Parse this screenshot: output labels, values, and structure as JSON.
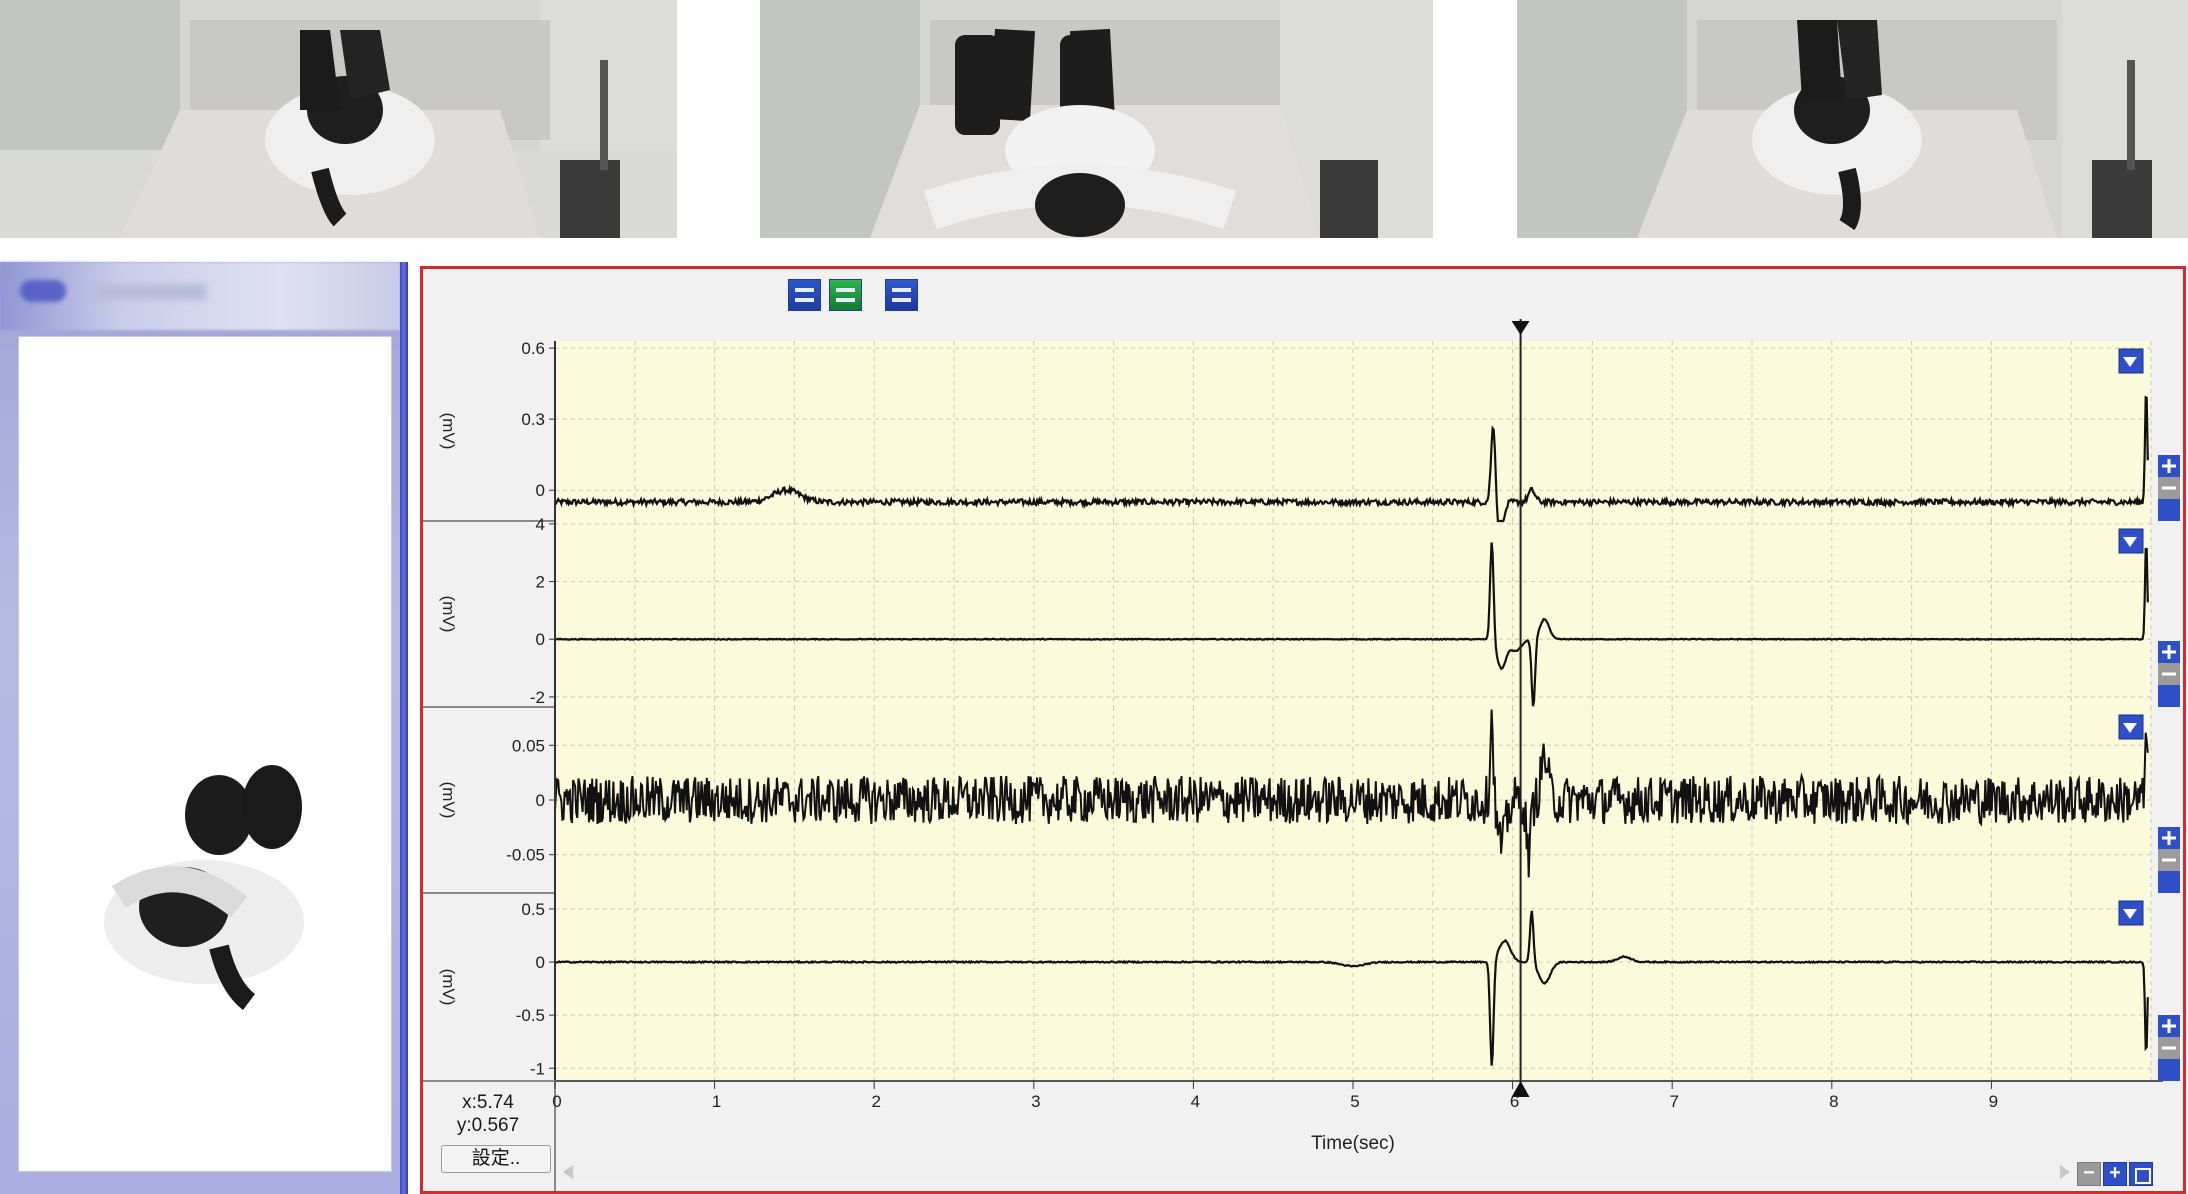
{
  "photos": [
    {
      "pose": "lying-on-left-side"
    },
    {
      "pose": "lying-supine"
    },
    {
      "pose": "lying-on-right-side"
    }
  ],
  "video_panel": {
    "title": ""
  },
  "toolbar": {
    "icons": [
      "waveform-mode-icon",
      "overlay-mode-icon",
      "spectrum-mode-icon"
    ]
  },
  "readout": {
    "x": "x:5.74",
    "y": "y:0.567"
  },
  "settings_label": "設定..",
  "colors": {
    "plot_background": "#fbfadb",
    "trace": "#111111",
    "grid": "#c9c9bd",
    "panel_border": "#d42a2a",
    "button_blue": "#2e4fc7"
  },
  "chart_data": {
    "type": "line",
    "xlabel": "Time(sec)",
    "xlim": [
      0,
      10
    ],
    "x_ticks": [
      "0",
      "1",
      "2",
      "3",
      "4",
      "5",
      "6",
      "7",
      "8",
      "9"
    ],
    "cursor_x": 6.05,
    "grid": true,
    "channels": [
      {
        "ylabel": "(mV)",
        "ylim": [
          -0.13,
          0.63
        ],
        "y_ticks": [
          {
            "v": 0.6,
            "t": "0.6"
          },
          {
            "v": 0.3,
            "t": "0.3"
          },
          {
            "v": 0,
            "t": "0"
          }
        ],
        "baseline": -0.05,
        "noise": 0.012,
        "events": [
          {
            "x": 1.45,
            "amp": 0.05,
            "w": 0.12
          },
          {
            "x": 5.88,
            "amp": 0.35,
            "w": 0.02
          },
          {
            "x": 5.92,
            "amp": -0.18,
            "w": 0.03
          },
          {
            "x": 6.12,
            "amp": 0.05,
            "w": 0.03
          },
          {
            "x": 9.97,
            "amp": 0.5,
            "w": 0.01
          }
        ]
      },
      {
        "ylabel": "(mV)",
        "ylim": [
          -2.35,
          4.1
        ],
        "y_ticks": [
          {
            "v": 4,
            "t": "4"
          },
          {
            "v": 2,
            "t": "2"
          },
          {
            "v": 0,
            "t": "0"
          },
          {
            "v": -2,
            "t": "-2"
          }
        ],
        "baseline": 0,
        "noise": 0.015,
        "events": [
          {
            "x": 5.87,
            "amp": 3.5,
            "w": 0.015
          },
          {
            "x": 5.93,
            "amp": -1.0,
            "w": 0.04
          },
          {
            "x": 6.02,
            "amp": -0.4,
            "w": 0.05
          },
          {
            "x": 6.13,
            "amp": -2.4,
            "w": 0.015
          },
          {
            "x": 6.2,
            "amp": 0.7,
            "w": 0.04
          },
          {
            "x": 9.97,
            "amp": 3.5,
            "w": 0.01
          }
        ]
      },
      {
        "ylabel": "(mV)",
        "ylim": [
          -0.085,
          0.085
        ],
        "y_ticks": [
          {
            "v": 0.05,
            "t": "0.05"
          },
          {
            "v": 0,
            "t": "0"
          },
          {
            "v": -0.05,
            "t": "-0.05"
          }
        ],
        "baseline": 0,
        "noise": 0.01,
        "events": [
          {
            "x": 5.87,
            "amp": 0.08,
            "w": 0.015
          },
          {
            "x": 5.93,
            "amp": -0.04,
            "w": 0.04
          },
          {
            "x": 6.1,
            "amp": -0.05,
            "w": 0.02
          },
          {
            "x": 6.2,
            "amp": 0.04,
            "w": 0.03
          },
          {
            "x": 9.97,
            "amp": 0.06,
            "w": 0.01
          }
        ]
      },
      {
        "ylabel": "(mV)",
        "ylim": [
          -1.12,
          0.65
        ],
        "y_ticks": [
          {
            "v": 0.5,
            "t": "0.5"
          },
          {
            "v": 0,
            "t": "0"
          },
          {
            "v": -0.5,
            "t": "-0.5"
          },
          {
            "v": -1,
            "t": "-1"
          }
        ],
        "baseline": 0,
        "noise": 0.006,
        "events": [
          {
            "x": 5.0,
            "amp": -0.04,
            "w": 0.1
          },
          {
            "x": 5.87,
            "amp": -1.0,
            "w": 0.015
          },
          {
            "x": 5.95,
            "amp": 0.2,
            "w": 0.05
          },
          {
            "x": 6.05,
            "amp": 0.0,
            "w": 0.05
          },
          {
            "x": 6.12,
            "amp": 0.5,
            "w": 0.015
          },
          {
            "x": 6.2,
            "amp": -0.2,
            "w": 0.05
          },
          {
            "x": 6.7,
            "amp": 0.05,
            "w": 0.06
          },
          {
            "x": 9.97,
            "amp": -0.9,
            "w": 0.01
          }
        ]
      }
    ]
  }
}
